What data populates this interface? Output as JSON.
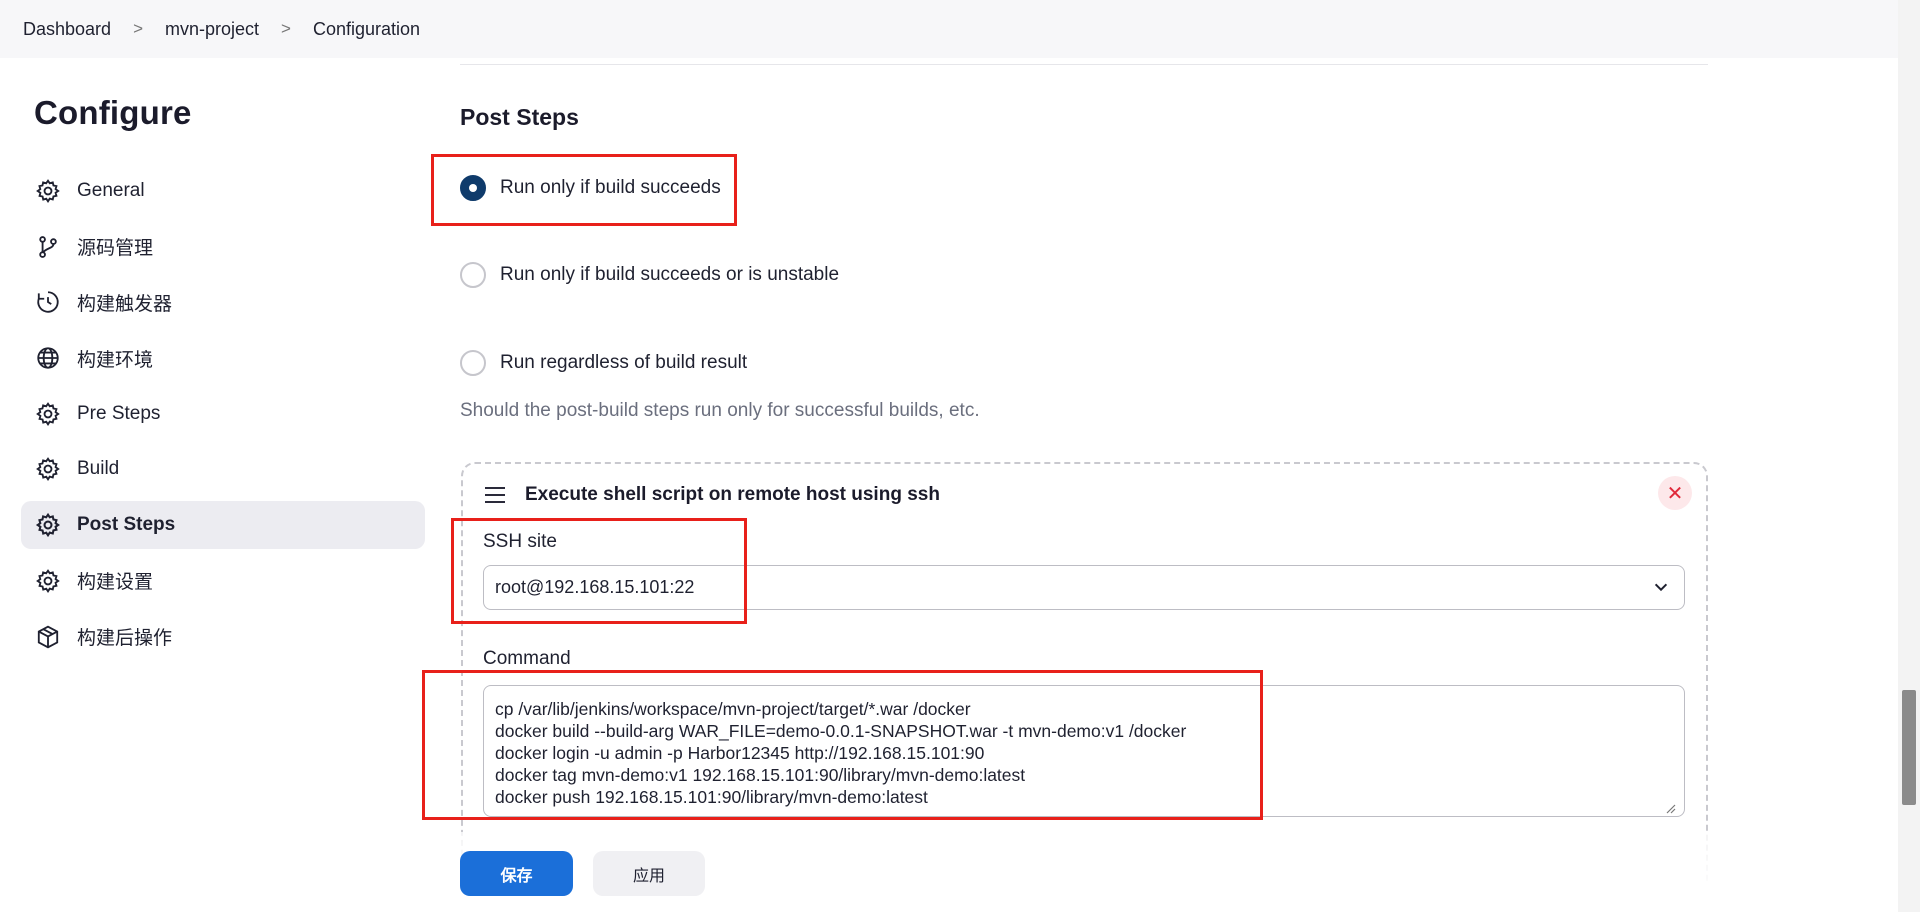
{
  "breadcrumb": {
    "items": [
      "Dashboard",
      "mvn-project",
      "Configuration"
    ],
    "separator": ">"
  },
  "sidebar": {
    "title": "Configure",
    "items": [
      {
        "label": "General",
        "icon": "gear-icon",
        "active": false
      },
      {
        "label": "源码管理",
        "icon": "branch-icon",
        "active": false
      },
      {
        "label": "构建触发器",
        "icon": "clock-icon",
        "active": false
      },
      {
        "label": "构建环境",
        "icon": "globe-icon",
        "active": false
      },
      {
        "label": "Pre Steps",
        "icon": "gear-icon",
        "active": false
      },
      {
        "label": "Build",
        "icon": "gear-icon",
        "active": false
      },
      {
        "label": "Post Steps",
        "icon": "gear-icon",
        "active": true
      },
      {
        "label": "构建设置",
        "icon": "gear-icon",
        "active": false
      },
      {
        "label": "构建后操作",
        "icon": "package-icon",
        "active": false
      }
    ]
  },
  "post_steps": {
    "title": "Post Steps",
    "options": [
      {
        "label": "Run only if build succeeds",
        "checked": true
      },
      {
        "label": "Run only if build succeeds or is unstable",
        "checked": false
      },
      {
        "label": "Run regardless of build result",
        "checked": false
      }
    ],
    "hint": "Should the post-build steps run only for successful builds, etc."
  },
  "builder": {
    "title": "Execute shell script on remote host using ssh",
    "close_symbol": "✕",
    "ssh_site_label": "SSH site",
    "ssh_site_value": "root@192.168.15.101:22",
    "command_label": "Command",
    "command": "cp /var/lib/jenkins/workspace/mvn-project/target/*.war /docker\ndocker build --build-arg WAR_FILE=demo-0.0.1-SNAPSHOT.war -t mvn-demo:v1 /docker\ndocker login -u admin -p Harbor12345 http://192.168.15.101:90\ndocker tag mvn-demo:v1 192.168.15.101:90/library/mvn-demo:latest\ndocker push 192.168.15.101:90/library/mvn-demo:latest"
  },
  "actions": {
    "save_label": "保存",
    "apply_label": "应用"
  },
  "colors": {
    "accent": "#1b6fd9",
    "radio_checked": "#0f3b6b",
    "annotation": "#e8201a",
    "close": "#e0293a"
  }
}
